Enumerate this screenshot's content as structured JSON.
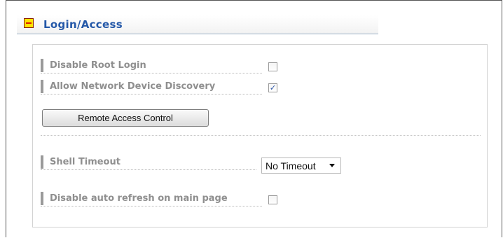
{
  "section": {
    "title": "Login/Access",
    "collapse_icon": "collapse-minus-icon"
  },
  "settings": {
    "disable_root_login": {
      "label": "Disable Root Login",
      "checked": false
    },
    "allow_discovery": {
      "label": "Allow Network Device Discovery",
      "checked": true
    },
    "remote_access_button": "Remote Access Control",
    "shell_timeout": {
      "label": "Shell Timeout",
      "value": "No Timeout"
    },
    "disable_auto_refresh": {
      "label": "Disable auto refresh on main page",
      "checked": false
    }
  },
  "colors": {
    "title": "#2458a8",
    "label": "#8f8f8f",
    "toggle_fill": "#ffe400",
    "toggle_bar": "#d91b00"
  }
}
